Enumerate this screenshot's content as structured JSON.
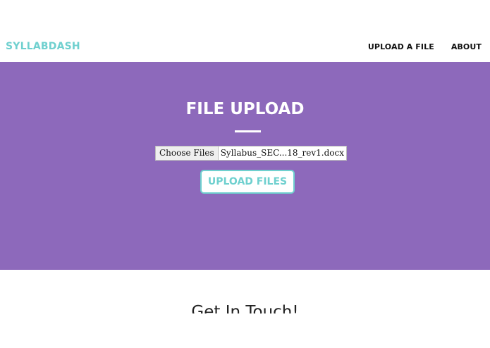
{
  "navbar": {
    "brand": "SYLLABDASH",
    "links": [
      {
        "label": "UPLOAD A FILE"
      },
      {
        "label": "ABOUT"
      }
    ]
  },
  "hero": {
    "title": "FILE UPLOAD",
    "file_input": {
      "button_label": "Choose Files",
      "file_name": "Syllabus_SEC...18_rev1.docx"
    },
    "submit_label": "UPLOAD FILES"
  },
  "contact": {
    "title": "Get In Touch!"
  },
  "colors": {
    "brand_accent": "#6fd0cf",
    "hero_background": "#8d69bb"
  }
}
